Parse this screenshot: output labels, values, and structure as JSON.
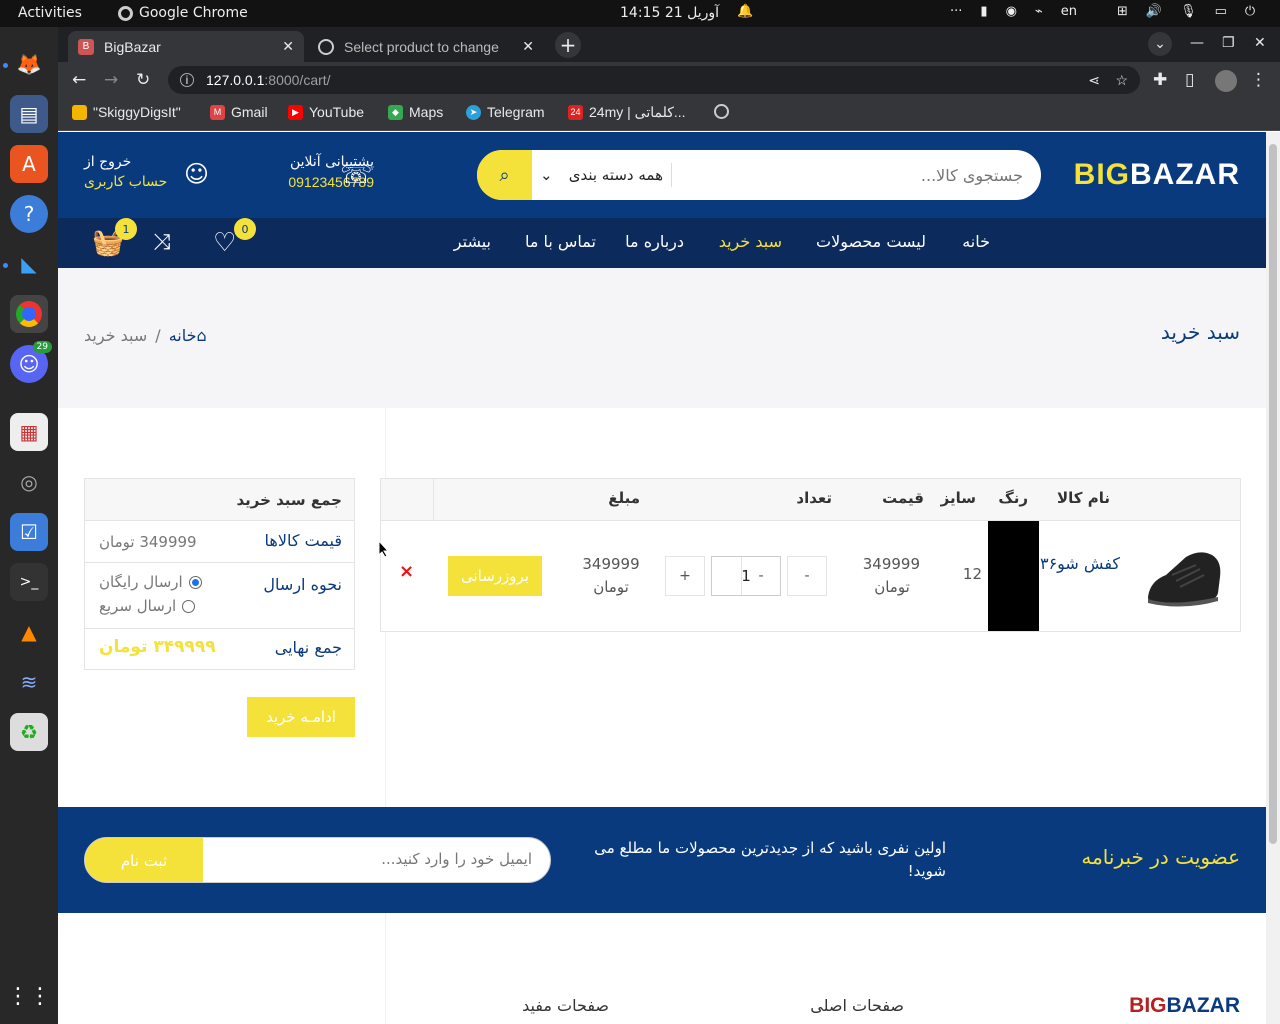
{
  "os": {
    "activities": "Activities",
    "app_name": "Google Chrome",
    "clock": "آوریل 21  14:15",
    "tray_dots": "···",
    "lang": "en"
  },
  "dock": {
    "discord_badge": "29"
  },
  "browser": {
    "tabs": [
      {
        "title": "BigBazar",
        "favicon": "B"
      },
      {
        "title": "Select product to change"
      }
    ],
    "url_host": "127.0.0.1",
    "url_rest": ":8000/cart/",
    "bookmarks": [
      "\"SkiggyDigsIt\"",
      "Gmail",
      "YouTube",
      "Maps",
      "Telegram",
      "24my | كلماتی..."
    ]
  },
  "site": {
    "logo_a": "BIG",
    "logo_b": "BAZAR",
    "search_placeholder": "جستجوی کالا...",
    "category_select": "همه دسته بندی",
    "support_label": "پشتیبانی آنلاین",
    "support_phone": "09123456789",
    "logout_label": "خروج از",
    "account_label": "حساب کاربری",
    "nav": [
      "خانه",
      "لیست محصولات",
      "سبد خرید",
      "درباره ما",
      "تماس با ما",
      "بیشتر"
    ],
    "wishlist_count": "0",
    "cart_count": "1",
    "page_title": "سبد خرید",
    "crumb_home": "خانه",
    "crumb_sep": "/",
    "crumb_current": "سبد خرید"
  },
  "cart": {
    "headers": {
      "name": "نام کالا",
      "color": "رنگ",
      "size": "سایز",
      "price": "قیمت",
      "qty": "تعداد",
      "amount": "مبلغ"
    },
    "item": {
      "name": "کفش شو۳۶",
      "color": "#000000",
      "size": "12",
      "price": "349999",
      "price_unit": "تومان",
      "qty": "1",
      "amount": "349999",
      "amount_unit": "تومان",
      "minus": "-",
      "plus": "+",
      "update_label": "بروزرسانی",
      "remove_label": "×"
    }
  },
  "summary": {
    "title": "جمع سبد خرید",
    "items_price_label": "قیمت کالاها",
    "items_price_value": "349999 تومان",
    "shipping_label": "نحوه ارسال",
    "shipping_options": [
      {
        "label": "ارسال رایگان",
        "selected": true
      },
      {
        "label": "ارسال سریع",
        "selected": false
      }
    ],
    "total_label": "جمع نهایی",
    "total_value": "۳۴۹۹۹۹ تومان",
    "continue_label": "ادامـه خرید"
  },
  "newsletter": {
    "title": "عضویت در خبرنامه",
    "description": "اولین نفری باشید که از جدیدترین محصولات ما مطلع می شوید!",
    "email_placeholder": "ایمیل خود را وارد کنید...",
    "submit_label": "ثبت نام"
  },
  "footer": {
    "logo_a": "BIG",
    "logo_b": "BAZAR",
    "col_main": "صفحات اصلی",
    "col_useful": "صفحات مفید"
  },
  "colors": {
    "brand_blue": "#0a3a7e",
    "nav_blue": "#0c2a5c",
    "accent_yellow": "#f4e23a"
  }
}
